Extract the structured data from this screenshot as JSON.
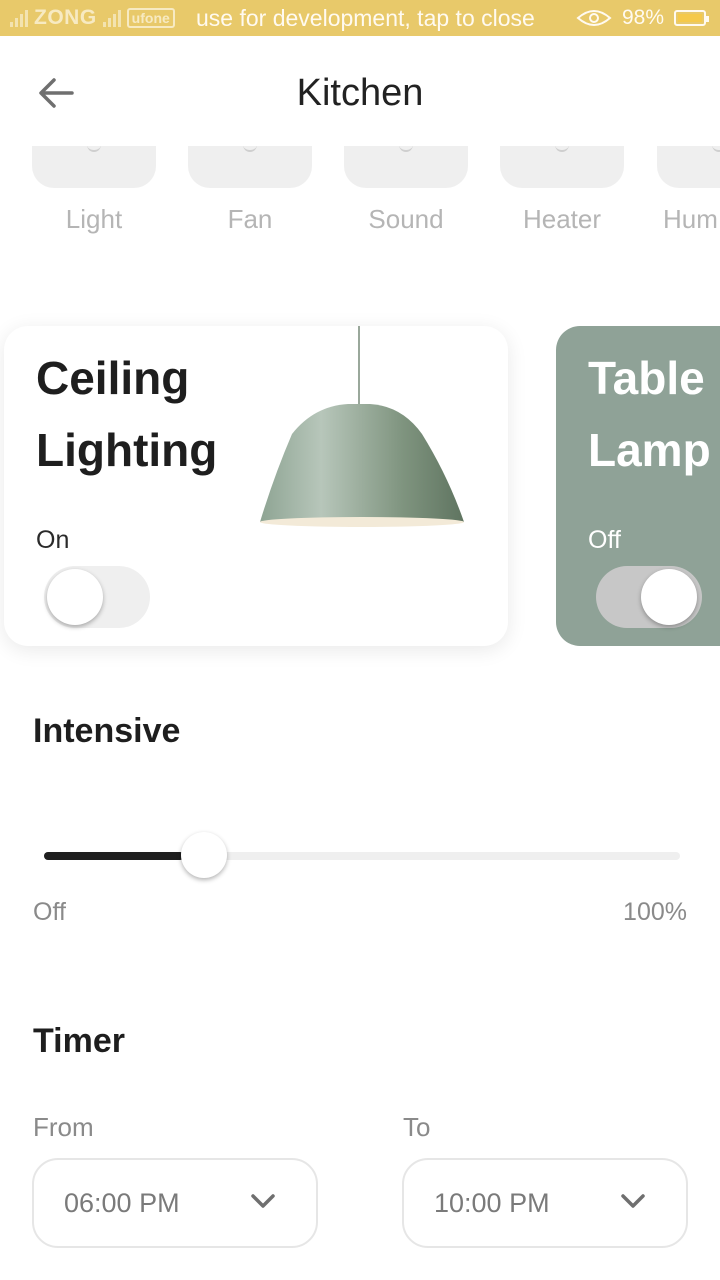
{
  "status_bar": {
    "carrier1": "ZONG",
    "carrier2": "ufone",
    "message": "use for development, tap to close",
    "battery": "98%"
  },
  "header": {
    "title": "Kitchen",
    "back_icon": "arrow-left-icon"
  },
  "categories": [
    {
      "label": "Light",
      "icon": "light-icon"
    },
    {
      "label": "Fan",
      "icon": "fan-icon"
    },
    {
      "label": "Sound",
      "icon": "sound-icon"
    },
    {
      "label": "Heater",
      "icon": "heater-icon"
    },
    {
      "label": "Hum",
      "icon": "humidifier-icon"
    }
  ],
  "devices": [
    {
      "title_line1": "Ceiling",
      "title_line2": "Lighting",
      "state": "On",
      "toggle_on": false,
      "background": "#ffffff"
    },
    {
      "title_line1": "Table",
      "title_line2": "Lamp",
      "state": "Off",
      "toggle_on": true,
      "background": "#8fa297"
    }
  ],
  "intensity": {
    "heading": "Intensive",
    "value_fraction": 0.22,
    "min_label": "Off",
    "max_label": "100%"
  },
  "timer": {
    "heading": "Timer",
    "from_label": "From",
    "from_value": "06:00 PM",
    "to_label": "To",
    "to_value": "10:00 PM"
  },
  "colors": {
    "accent_dark": "#1f1f1f",
    "card_sage": "#8fa297",
    "status_bar": "#e8c96a"
  }
}
